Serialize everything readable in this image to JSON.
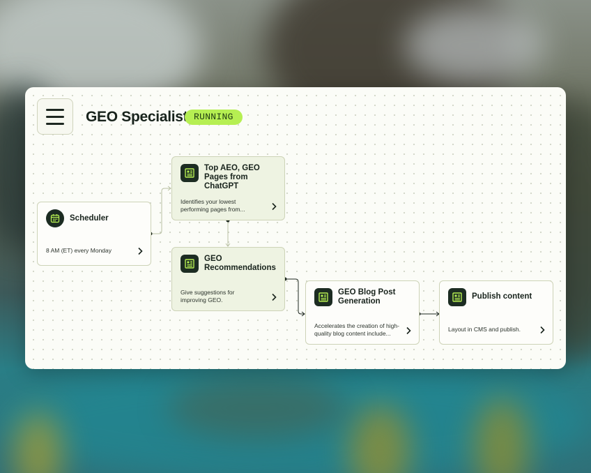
{
  "header": {
    "title": "GEO Specialist",
    "status": "RUNNING"
  },
  "nodes": [
    {
      "id": "scheduler",
      "title": "Scheduler",
      "desc": "8 AM (ET) every Monday",
      "icon": "calendar-icon"
    },
    {
      "id": "top-pages",
      "title": "Top AEO, GEO Pages from ChatGPT",
      "desc": "Identifies your lowest performing pages from...",
      "icon": "report-icon"
    },
    {
      "id": "geo-recs",
      "title": "GEO Recommendations",
      "desc": "Give suggestions for improving GEO.",
      "icon": "report-icon"
    },
    {
      "id": "blog-gen",
      "title": "GEO Blog Post Generation",
      "desc": "Accelerates the creation of high-quality blog content include...",
      "icon": "report-icon"
    },
    {
      "id": "publish",
      "title": "Publish content",
      "desc": "Layout in CMS and publish.",
      "icon": "report-icon"
    }
  ],
  "colors": {
    "accent": "#b6ef52",
    "icon_bg": "#1c2c22",
    "node_green": "#eef3e2",
    "node_border": "#cdd3b7"
  }
}
